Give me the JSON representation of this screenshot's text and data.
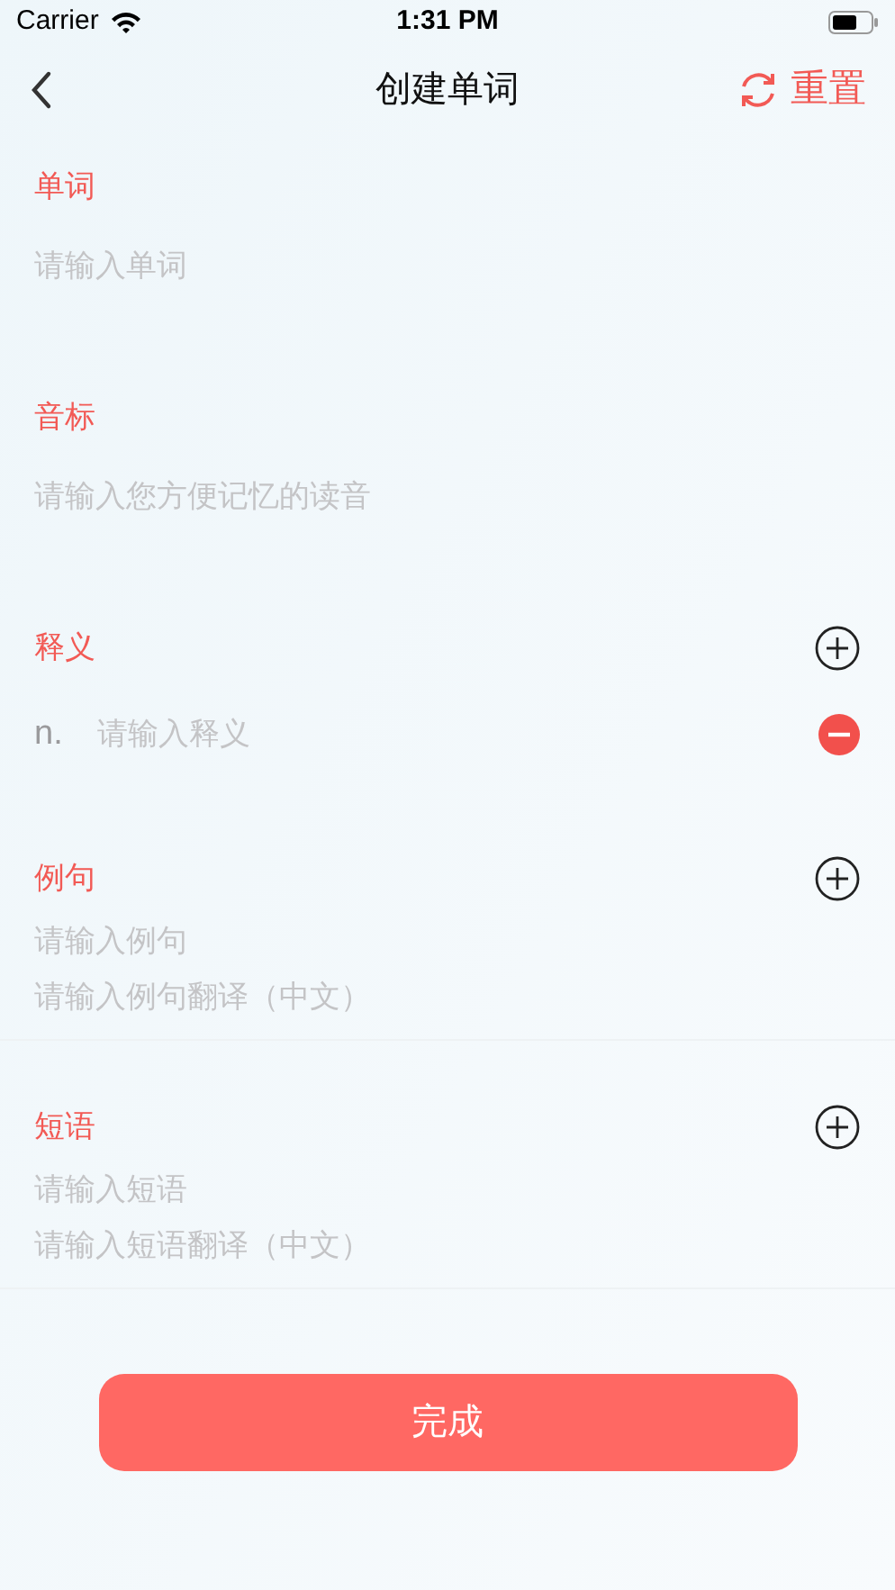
{
  "status_bar": {
    "carrier": "Carrier",
    "time": "1:31 PM"
  },
  "nav": {
    "title": "创建单词",
    "reset_label": "重置"
  },
  "sections": [
    {
      "kind": "single",
      "label": "单词",
      "placeholder": "请输入单词"
    },
    {
      "kind": "single",
      "label": "音标",
      "placeholder": "请输入您方便记忆的读音"
    },
    {
      "kind": "definition",
      "label": "释义",
      "rows": [
        {
          "pos": "n.",
          "placeholder": "请输入释义"
        }
      ]
    },
    {
      "kind": "pair",
      "label": "例句",
      "placeholders": [
        "请输入例句",
        "请输入例句翻译（中文）"
      ]
    },
    {
      "kind": "pair",
      "label": "短语",
      "placeholders": [
        "请输入短语",
        "请输入短语翻译（中文）"
      ]
    }
  ],
  "submit": "完成"
}
